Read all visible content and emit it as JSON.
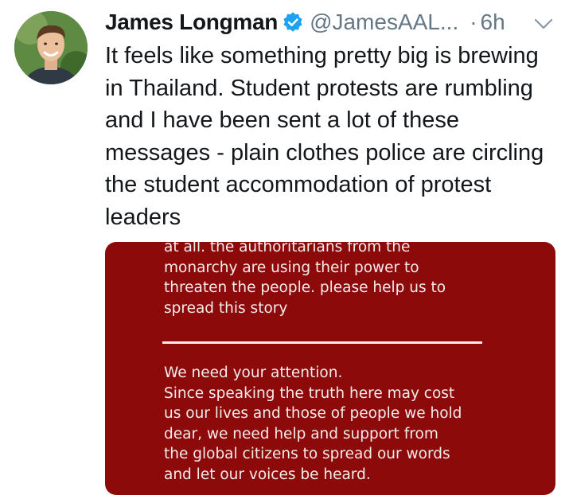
{
  "user": {
    "display_name": "James Longman",
    "handle": "@JamesAAL...",
    "verified": true
  },
  "meta": {
    "separator": "·",
    "time": "6h"
  },
  "tweet": {
    "text": "It feels like something pretty big is brewing in Thailand. Student protests are rumbling and I have been sent a lot of these messages - plain clothes police are circling the student accommodation of protest leaders"
  },
  "media": {
    "paragraph_top": "at all. the authoritarians from the\nmonarchy are using their power to\nthreaten the people. please help us to\nspread this story",
    "paragraph_bottom": "We need your attention.\nSince speaking the truth here may cost\nus our lives and those of people we hold\ndear, we need help and support from\nthe global citizens to spread our words\nand let our voices be heard.",
    "background_color": "#8c0a0a"
  },
  "colors": {
    "verified_badge": "#1da1f2",
    "secondary_text": "#657786"
  },
  "icons": {
    "verified": "verified-badge-icon",
    "menu": "chevron-down-icon"
  }
}
